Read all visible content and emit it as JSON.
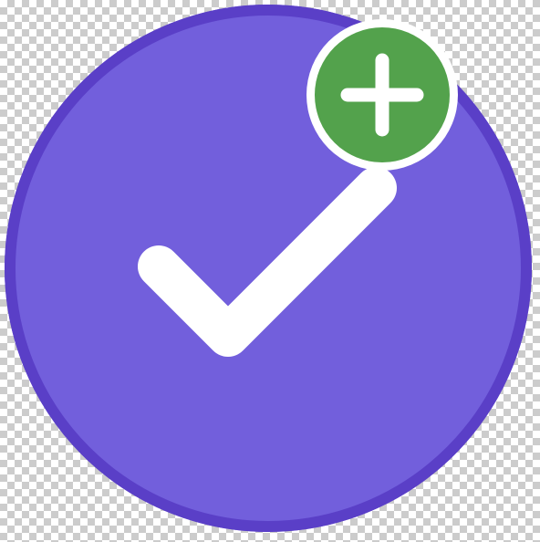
{
  "icon": {
    "name": "add-approved-check-icon",
    "badge_icon": "plus-icon",
    "main_icon": "checkmark-icon"
  },
  "colors": {
    "circle_fill": "#725fdc",
    "circle_ring": "#5a3fc7",
    "check_stroke": "#ffffff",
    "badge_fill": "#53a24c",
    "badge_border": "#ffffff",
    "plus_stroke": "#ffffff"
  }
}
